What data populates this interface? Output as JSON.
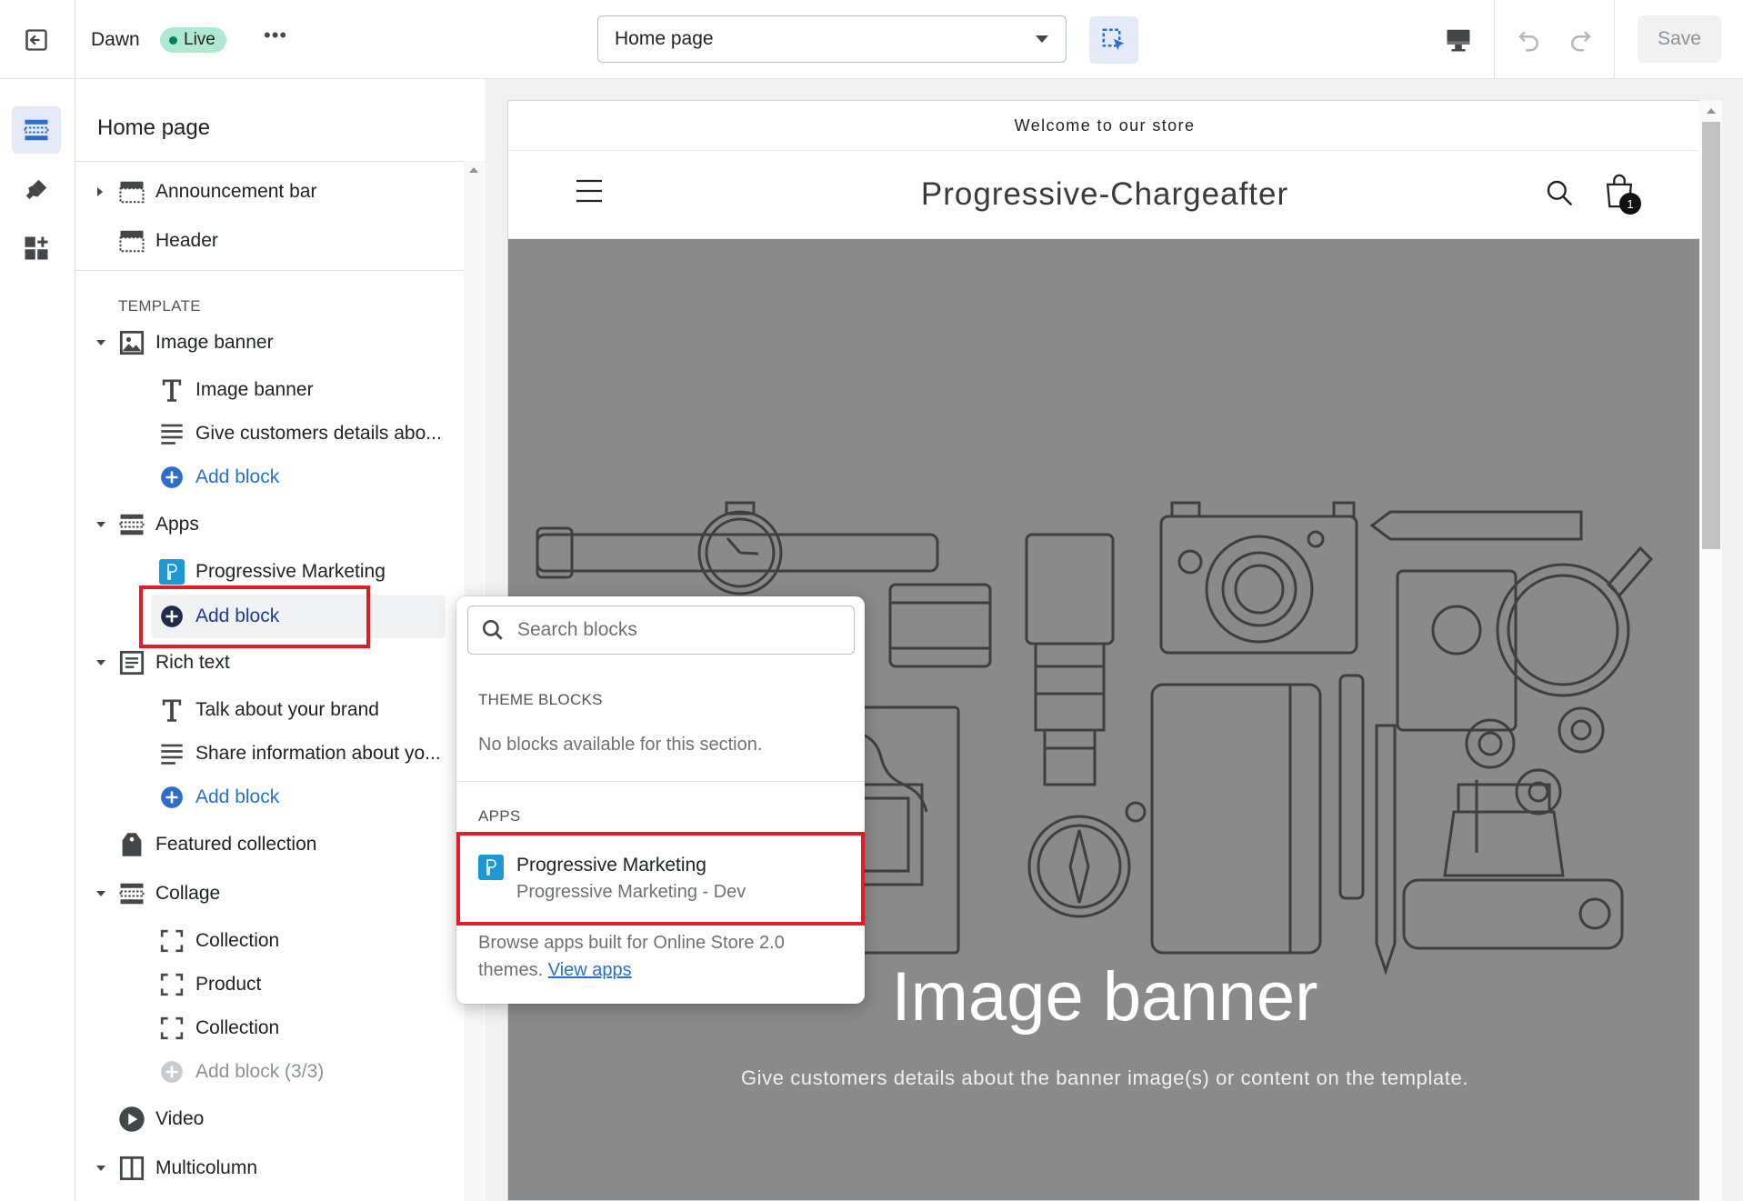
{
  "topbar": {
    "theme_name": "Dawn",
    "status_badge": "Live",
    "more_label": "•••",
    "page_select": "Home page",
    "save_label": "Save"
  },
  "sidebar": {
    "title": "Home page",
    "sections_top": [
      {
        "label": "Announcement bar",
        "icon": "section-icon"
      },
      {
        "label": "Header",
        "icon": "header-icon"
      }
    ],
    "template_heading": "TEMPLATE",
    "image_banner": {
      "label": "Image banner",
      "blocks": [
        "Image banner",
        "Give customers details abo..."
      ],
      "add_block": "Add block"
    },
    "apps": {
      "label": "Apps",
      "blocks": [
        "Progressive Marketing"
      ],
      "add_block": "Add block"
    },
    "rich_text": {
      "label": "Rich text",
      "blocks": [
        "Talk about your brand",
        "Share information about yo..."
      ],
      "add_block": "Add block"
    },
    "featured_collection": {
      "label": "Featured collection"
    },
    "collage": {
      "label": "Collage",
      "blocks": [
        "Collection",
        "Product",
        "Collection"
      ],
      "add_block": "Add block (3/3)"
    },
    "video": {
      "label": "Video"
    },
    "multicolumn": {
      "label": "Multicolumn"
    }
  },
  "popover": {
    "search_placeholder": "Search blocks",
    "theme_blocks_heading": "THEME BLOCKS",
    "theme_blocks_empty": "No blocks available for this section.",
    "apps_heading": "APPS",
    "app_item": {
      "title": "Progressive Marketing",
      "subtitle": "Progressive Marketing - Dev"
    },
    "footer_text_1": "Browse apps built for Online Store 2.0",
    "footer_text_2": "themes.",
    "footer_link": "View apps"
  },
  "preview": {
    "announcement": "Welcome to our store",
    "store_name": "Progressive-Chargeafter",
    "cart_count": "1",
    "banner_title": "Image banner",
    "banner_subtitle": "Give customers details about the banner image(s) or content on the template."
  },
  "colors": {
    "accent_blue": "#2c6ecb",
    "highlight_red": "#e01e2b",
    "live_badge": "#aee9d1",
    "banner_grey": "#8a8a8a"
  }
}
